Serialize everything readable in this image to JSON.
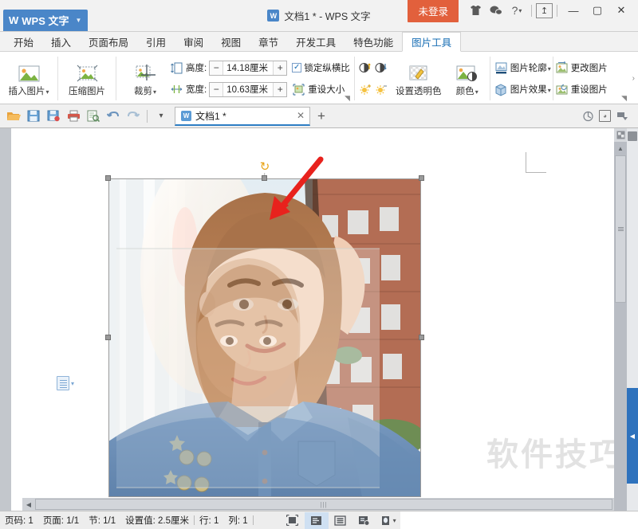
{
  "window": {
    "app_tab": "WPS 文字",
    "title": "文档1 * - WPS 文字",
    "login_button": "未登录",
    "minimize": "—",
    "maximize": "▢",
    "close": "✕",
    "help": "?",
    "accent_blue": "#4a86c8",
    "accent_orange": "#e2603c"
  },
  "ribbon_tabs": [
    {
      "label": "开始",
      "active": false
    },
    {
      "label": "插入",
      "active": false
    },
    {
      "label": "页面布局",
      "active": false
    },
    {
      "label": "引用",
      "active": false
    },
    {
      "label": "审阅",
      "active": false
    },
    {
      "label": "视图",
      "active": false
    },
    {
      "label": "章节",
      "active": false
    },
    {
      "label": "开发工具",
      "active": false
    },
    {
      "label": "特色功能",
      "active": false
    },
    {
      "label": "图片工具",
      "active": true
    }
  ],
  "ribbon": {
    "insert_picture": "插入图片",
    "compress_picture": "压缩图片",
    "crop": "裁剪",
    "height_label": "高度:",
    "height_value": "14.18厘米",
    "width_label": "宽度:",
    "width_value": "10.63厘米",
    "minus": "−",
    "plus": "+",
    "lock_aspect": "锁定纵横比",
    "lock_aspect_checked": "✓",
    "reset_size": "重设大小",
    "set_transparent_color": "设置透明色",
    "color": "颜色",
    "picture_outline": "图片轮廓",
    "picture_effects": "图片效果",
    "change_picture": "更改图片",
    "reset_picture": "重设图片"
  },
  "quick_access": {
    "open": "📂",
    "save": "💾",
    "save_as": "🖫",
    "print": "🖨",
    "print_preview": "🔍",
    "undo": "↶",
    "redo": "↷",
    "more": "▾",
    "new_tab": "+"
  },
  "doc_tab": {
    "label": "文档1 *",
    "close": "✕"
  },
  "document": {
    "watermark": "软件技巧",
    "paste_options_caret": "▾"
  },
  "status_bar": {
    "page_number_label": "页码:",
    "page_number": "1",
    "page_label": "页面:",
    "page_value": "1/1",
    "section_label": "节:",
    "section_value": "1/1",
    "setting_label": "设置值:",
    "setting_value": "2.5厘米",
    "row_label": "行:",
    "row_value": "1",
    "col_label": "列:",
    "col_value": "1"
  }
}
